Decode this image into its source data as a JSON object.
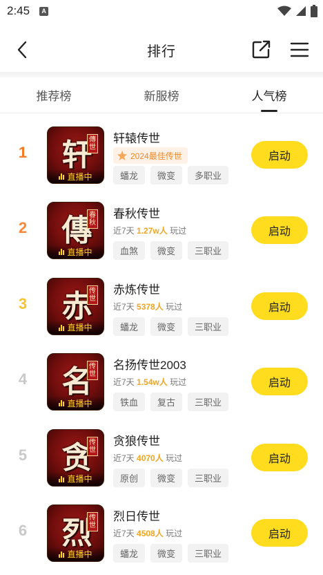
{
  "status": {
    "time": "2:45",
    "notif_letter": "A"
  },
  "header": {
    "title": "排行"
  },
  "tabs": [
    {
      "label": "推荐榜",
      "active": false
    },
    {
      "label": "新服榜",
      "active": false
    },
    {
      "label": "人气榜",
      "active": true
    }
  ],
  "live_label": "直播中",
  "start_label": "启动",
  "play_suffix": "玩过",
  "play_prefix": "近7天",
  "games": [
    {
      "rank": "1",
      "rank_color": "#f57b24",
      "name": "轩辕传世",
      "award": "2024最佳传世",
      "count": "",
      "tags": [
        "蟠龙",
        "微变",
        "多职业"
      ],
      "glyph": "轩",
      "seal": "傳世"
    },
    {
      "rank": "2",
      "rank_color": "#f7883a",
      "name": "春秋传世",
      "award": "",
      "count": "1.27w人",
      "tags": [
        "血煞",
        "微变",
        "三职业"
      ],
      "glyph": "傳",
      "seal": "春秋"
    },
    {
      "rank": "3",
      "rank_color": "#f7c234",
      "name": "赤炼传世",
      "award": "",
      "count": "5378人",
      "tags": [
        "蟠龙",
        "微变",
        "三职业"
      ],
      "glyph": "赤",
      "seal": "传世"
    },
    {
      "rank": "4",
      "rank_color": "#c9c9c9",
      "name": "名扬传世2003",
      "award": "",
      "count": "1.54w人",
      "tags": [
        "铁血",
        "复古",
        "三职业"
      ],
      "glyph": "名",
      "seal": "传世"
    },
    {
      "rank": "5",
      "rank_color": "#c9c9c9",
      "name": "贪狼传世",
      "award": "",
      "count": "4070人",
      "tags": [
        "原创",
        "微变",
        "三职业"
      ],
      "glyph": "贪",
      "seal": "传世"
    },
    {
      "rank": "6",
      "rank_color": "#c9c9c9",
      "name": "烈日传世",
      "award": "",
      "count": "4508人",
      "tags": [
        "蟠龙",
        "微变",
        "三职业"
      ],
      "glyph": "烈",
      "seal": "传世"
    }
  ],
  "colors": {
    "accent": "#ffdc1e",
    "hot_text": "#f2a51f",
    "award_bg": "#fff1e6"
  }
}
